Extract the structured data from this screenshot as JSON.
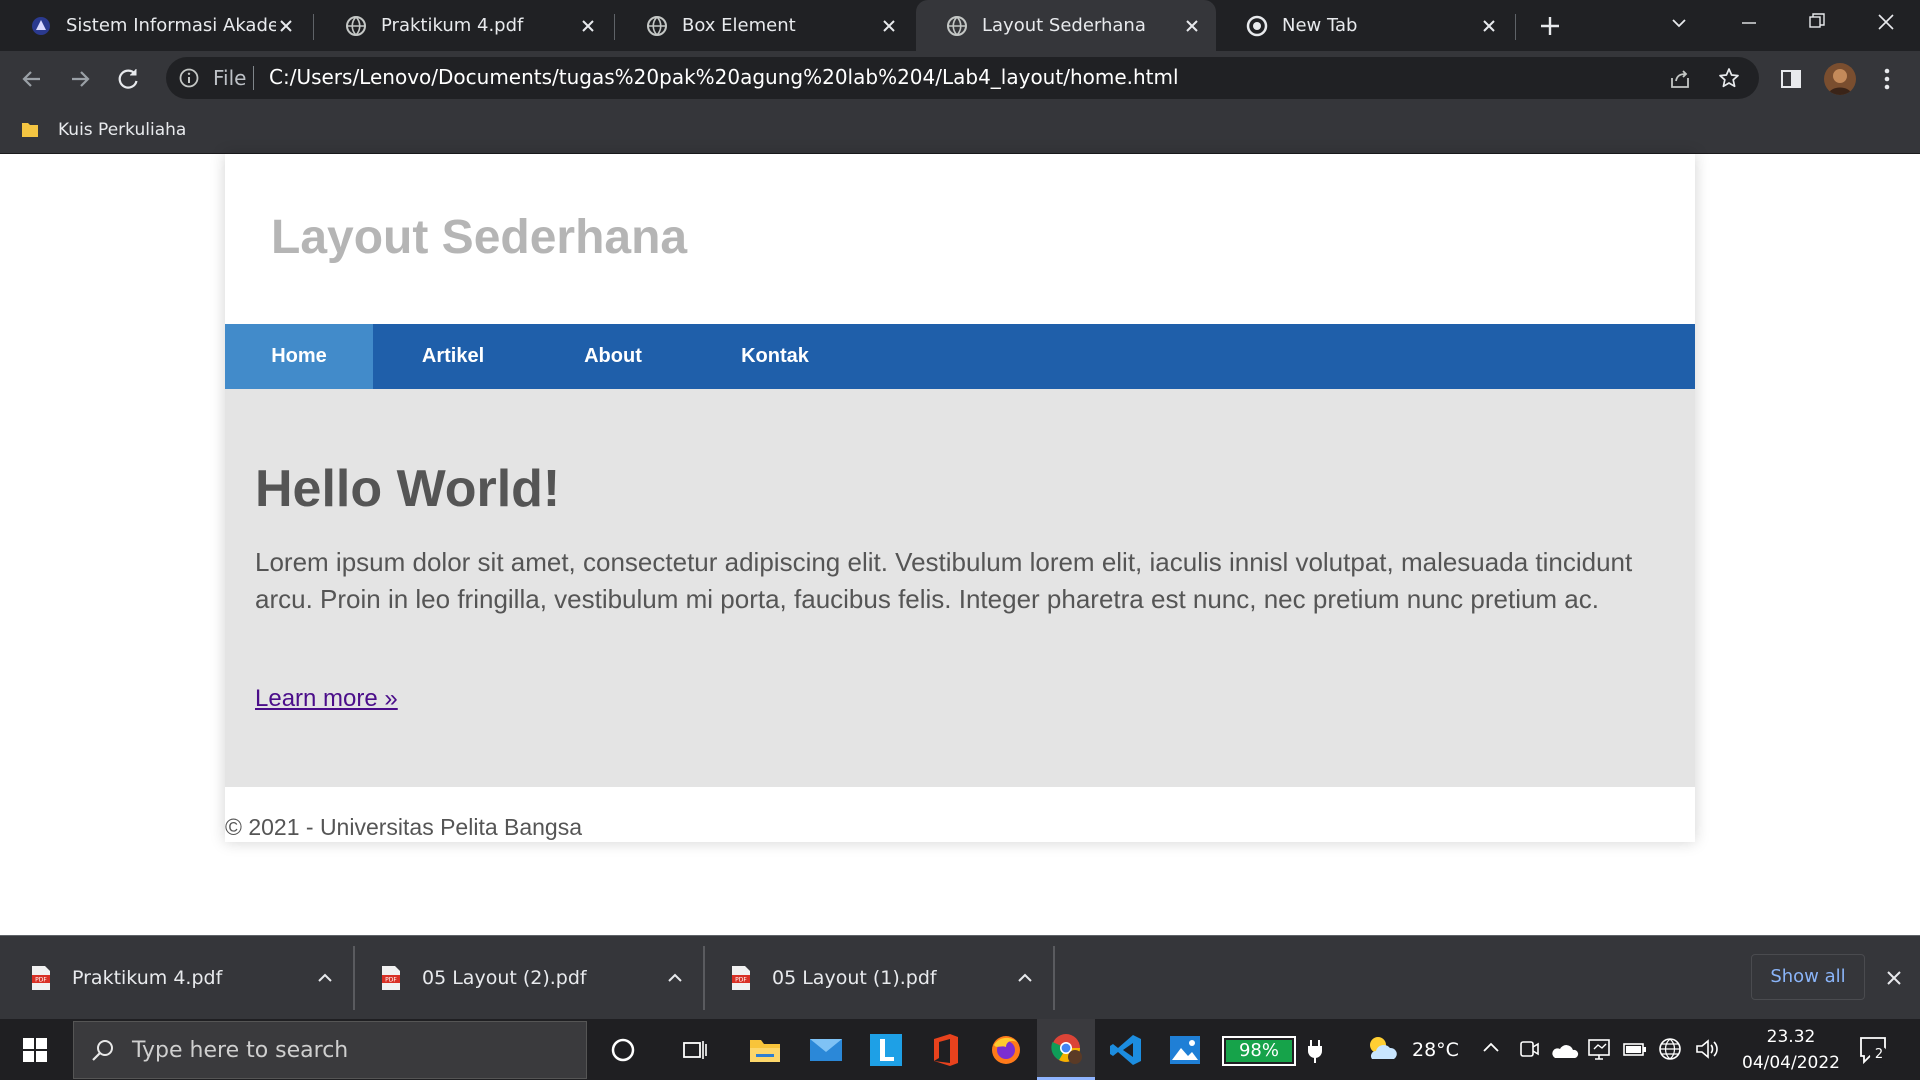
{
  "browser": {
    "tabs": [
      {
        "title": "Sistem Informasi Akademik",
        "icon": "university-favicon"
      },
      {
        "title": "Praktikum 4.pdf",
        "icon": "globe-icon"
      },
      {
        "title": "Box Element",
        "icon": "globe-icon"
      },
      {
        "title": "Layout Sederhana",
        "icon": "globe-icon",
        "active": true
      },
      {
        "title": "New Tab",
        "icon": "chrome-icon"
      }
    ],
    "address_prefix": "File",
    "url": "C:/Users/Lenovo/Documents/tugas%20pak%20agung%20lab%204/Lab4_layout/home.html",
    "bookmarks": [
      {
        "label": "Kuis Perkuliaha",
        "icon": "folder-icon"
      }
    ]
  },
  "page": {
    "site_title": "Layout Sederhana",
    "nav": [
      {
        "label": "Home",
        "active": true
      },
      {
        "label": "Artikel"
      },
      {
        "label": "About"
      },
      {
        "label": "Kontak"
      }
    ],
    "hero": {
      "title": "Hello World!",
      "text": "Lorem ipsum dolor sit amet, consectetur adipiscing elit. Vestibulum lorem elit, iaculis innisl volutpat, malesuada tincidunt arcu. Proin in leo fringilla, vestibulum mi porta, faucibus felis. Integer pharetra est nunc, nec pretium nunc pretium ac.",
      "link": "Learn more »"
    },
    "footer": "© 2021 - Universitas Pelita Bangsa"
  },
  "downloads": {
    "items": [
      {
        "name": "Praktikum 4.pdf"
      },
      {
        "name": "05 Layout (2).pdf"
      },
      {
        "name": "05 Layout (1).pdf"
      }
    ],
    "show_all": "Show all"
  },
  "taskbar": {
    "search_placeholder": "Type here to search",
    "battery": "98%",
    "weather": "28°C",
    "time": "23.32",
    "date": "04/04/2022",
    "notifications": "2"
  },
  "colors": {
    "nav_bg": "#1f5faa",
    "nav_active": "#428bca",
    "hero_bg": "#e4e4e4",
    "site_title": "#b5b5b5",
    "link": "#4b0e8a"
  }
}
